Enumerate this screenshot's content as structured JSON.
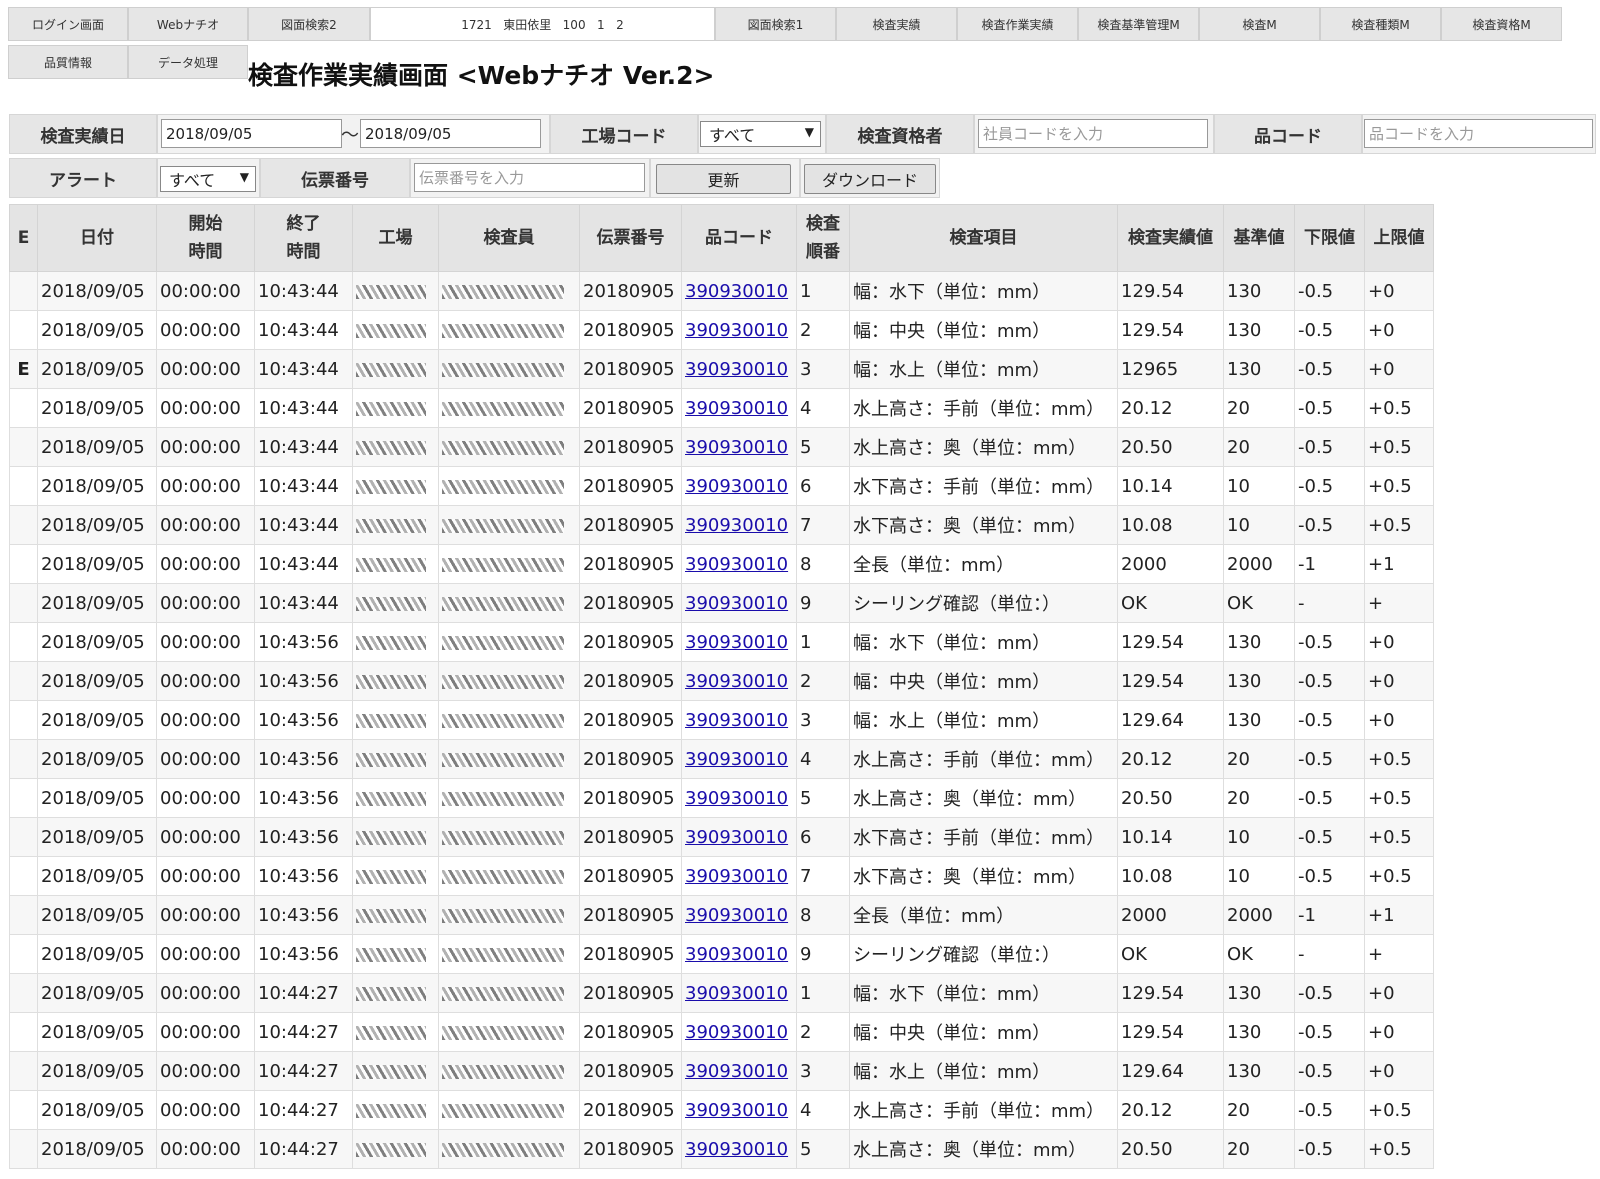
{
  "nav": {
    "row1": [
      "ログイン画面",
      "Webナチオ",
      "図面検索2",
      "図面検索1",
      "検査実績",
      "検査作業実績",
      "検査基準管理M",
      "検査M",
      "検査種類M",
      "検査資格M"
    ],
    "row2": [
      "品質情報",
      "データ処理"
    ],
    "user_info": "1721   東田依里   100   1   2"
  },
  "page_title": "検査作業実績画面 <Webナチオ Ver.2>",
  "filters": {
    "date_label": "検査実績日",
    "date_from": "2018/09/05",
    "date_to": "2018/09/05",
    "tilde": "〜",
    "factory_label": "工場コード",
    "factory_value": "すべて",
    "inspector_label": "検査資格者",
    "inspector_placeholder": "社員コードを入力",
    "product_label": "品コード",
    "product_placeholder": "品コードを入力",
    "alert_label": "アラート",
    "alert_value": "すべて",
    "slip_label": "伝票番号",
    "slip_placeholder": "伝票番号を入力",
    "update_button": "更新",
    "download_button": "ダウンロード"
  },
  "table": {
    "headers": {
      "e": "E",
      "date": "日付",
      "start_1": "開始",
      "start_2": "時間",
      "end_1": "終了",
      "end_2": "時間",
      "factory": "工場",
      "inspector": "検査員",
      "slip": "伝票番号",
      "product": "品コード",
      "order_1": "検査",
      "order_2": "順番",
      "item": "検査項目",
      "result": "検査実績値",
      "standard": "基準値",
      "lower": "下限値",
      "upper": "上限値"
    },
    "rows": [
      {
        "e": "",
        "date": "2018/09/05",
        "start": "00:00:00",
        "end": "10:43:44",
        "slip": "20180905",
        "product": "390930010",
        "order": "1",
        "item": "幅：水下（単位：mm）",
        "result": "129.54",
        "standard": "130",
        "lower": "-0.5",
        "upper": "+0"
      },
      {
        "e": "",
        "date": "2018/09/05",
        "start": "00:00:00",
        "end": "10:43:44",
        "slip": "20180905",
        "product": "390930010",
        "order": "2",
        "item": "幅：中央（単位：mm）",
        "result": "129.54",
        "standard": "130",
        "lower": "-0.5",
        "upper": "+0"
      },
      {
        "e": "E",
        "date": "2018/09/05",
        "start": "00:00:00",
        "end": "10:43:44",
        "slip": "20180905",
        "product": "390930010",
        "order": "3",
        "item": "幅：水上（単位：mm）",
        "result": "12965",
        "standard": "130",
        "lower": "-0.5",
        "upper": "+0"
      },
      {
        "e": "",
        "date": "2018/09/05",
        "start": "00:00:00",
        "end": "10:43:44",
        "slip": "20180905",
        "product": "390930010",
        "order": "4",
        "item": "水上高さ：手前（単位：mm）",
        "result": "20.12",
        "standard": "20",
        "lower": "-0.5",
        "upper": "+0.5"
      },
      {
        "e": "",
        "date": "2018/09/05",
        "start": "00:00:00",
        "end": "10:43:44",
        "slip": "20180905",
        "product": "390930010",
        "order": "5",
        "item": "水上高さ：奥（単位：mm）",
        "result": "20.50",
        "standard": "20",
        "lower": "-0.5",
        "upper": "+0.5"
      },
      {
        "e": "",
        "date": "2018/09/05",
        "start": "00:00:00",
        "end": "10:43:44",
        "slip": "20180905",
        "product": "390930010",
        "order": "6",
        "item": "水下高さ：手前（単位：mm）",
        "result": "10.14",
        "standard": "10",
        "lower": "-0.5",
        "upper": "+0.5"
      },
      {
        "e": "",
        "date": "2018/09/05",
        "start": "00:00:00",
        "end": "10:43:44",
        "slip": "20180905",
        "product": "390930010",
        "order": "7",
        "item": "水下高さ：奥（単位：mm）",
        "result": "10.08",
        "standard": "10",
        "lower": "-0.5",
        "upper": "+0.5"
      },
      {
        "e": "",
        "date": "2018/09/05",
        "start": "00:00:00",
        "end": "10:43:44",
        "slip": "20180905",
        "product": "390930010",
        "order": "8",
        "item": "全長（単位：mm）",
        "result": "2000",
        "standard": "2000",
        "lower": "-1",
        "upper": "+1"
      },
      {
        "e": "",
        "date": "2018/09/05",
        "start": "00:00:00",
        "end": "10:43:44",
        "slip": "20180905",
        "product": "390930010",
        "order": "9",
        "item": "シーリング確認（単位：）",
        "result": "OK",
        "standard": "OK",
        "lower": "-",
        "upper": "+"
      },
      {
        "e": "",
        "date": "2018/09/05",
        "start": "00:00:00",
        "end": "10:43:56",
        "slip": "20180905",
        "product": "390930010",
        "order": "1",
        "item": "幅：水下（単位：mm）",
        "result": "129.54",
        "standard": "130",
        "lower": "-0.5",
        "upper": "+0"
      },
      {
        "e": "",
        "date": "2018/09/05",
        "start": "00:00:00",
        "end": "10:43:56",
        "slip": "20180905",
        "product": "390930010",
        "order": "2",
        "item": "幅：中央（単位：mm）",
        "result": "129.54",
        "standard": "130",
        "lower": "-0.5",
        "upper": "+0"
      },
      {
        "e": "",
        "date": "2018/09/05",
        "start": "00:00:00",
        "end": "10:43:56",
        "slip": "20180905",
        "product": "390930010",
        "order": "3",
        "item": "幅：水上（単位：mm）",
        "result": "129.64",
        "standard": "130",
        "lower": "-0.5",
        "upper": "+0"
      },
      {
        "e": "",
        "date": "2018/09/05",
        "start": "00:00:00",
        "end": "10:43:56",
        "slip": "20180905",
        "product": "390930010",
        "order": "4",
        "item": "水上高さ：手前（単位：mm）",
        "result": "20.12",
        "standard": "20",
        "lower": "-0.5",
        "upper": "+0.5"
      },
      {
        "e": "",
        "date": "2018/09/05",
        "start": "00:00:00",
        "end": "10:43:56",
        "slip": "20180905",
        "product": "390930010",
        "order": "5",
        "item": "水上高さ：奥（単位：mm）",
        "result": "20.50",
        "standard": "20",
        "lower": "-0.5",
        "upper": "+0.5"
      },
      {
        "e": "",
        "date": "2018/09/05",
        "start": "00:00:00",
        "end": "10:43:56",
        "slip": "20180905",
        "product": "390930010",
        "order": "6",
        "item": "水下高さ：手前（単位：mm）",
        "result": "10.14",
        "standard": "10",
        "lower": "-0.5",
        "upper": "+0.5"
      },
      {
        "e": "",
        "date": "2018/09/05",
        "start": "00:00:00",
        "end": "10:43:56",
        "slip": "20180905",
        "product": "390930010",
        "order": "7",
        "item": "水下高さ：奥（単位：mm）",
        "result": "10.08",
        "standard": "10",
        "lower": "-0.5",
        "upper": "+0.5"
      },
      {
        "e": "",
        "date": "2018/09/05",
        "start": "00:00:00",
        "end": "10:43:56",
        "slip": "20180905",
        "product": "390930010",
        "order": "8",
        "item": "全長（単位：mm）",
        "result": "2000",
        "standard": "2000",
        "lower": "-1",
        "upper": "+1"
      },
      {
        "e": "",
        "date": "2018/09/05",
        "start": "00:00:00",
        "end": "10:43:56",
        "slip": "20180905",
        "product": "390930010",
        "order": "9",
        "item": "シーリング確認（単位：）",
        "result": "OK",
        "standard": "OK",
        "lower": "-",
        "upper": "+"
      },
      {
        "e": "",
        "date": "2018/09/05",
        "start": "00:00:00",
        "end": "10:44:27",
        "slip": "20180905",
        "product": "390930010",
        "order": "1",
        "item": "幅：水下（単位：mm）",
        "result": "129.54",
        "standard": "130",
        "lower": "-0.5",
        "upper": "+0"
      },
      {
        "e": "",
        "date": "2018/09/05",
        "start": "00:00:00",
        "end": "10:44:27",
        "slip": "20180905",
        "product": "390930010",
        "order": "2",
        "item": "幅：中央（単位：mm）",
        "result": "129.54",
        "standard": "130",
        "lower": "-0.5",
        "upper": "+0"
      },
      {
        "e": "",
        "date": "2018/09/05",
        "start": "00:00:00",
        "end": "10:44:27",
        "slip": "20180905",
        "product": "390930010",
        "order": "3",
        "item": "幅：水上（単位：mm）",
        "result": "129.64",
        "standard": "130",
        "lower": "-0.5",
        "upper": "+0"
      },
      {
        "e": "",
        "date": "2018/09/05",
        "start": "00:00:00",
        "end": "10:44:27",
        "slip": "20180905",
        "product": "390930010",
        "order": "4",
        "item": "水上高さ：手前（単位：mm）",
        "result": "20.12",
        "standard": "20",
        "lower": "-0.5",
        "upper": "+0.5"
      },
      {
        "e": "",
        "date": "2018/09/05",
        "start": "00:00:00",
        "end": "10:44:27",
        "slip": "20180905",
        "product": "390930010",
        "order": "5",
        "item": "水上高さ：奥（単位：mm）",
        "result": "20.50",
        "standard": "20",
        "lower": "-0.5",
        "upper": "+0.5"
      }
    ]
  }
}
